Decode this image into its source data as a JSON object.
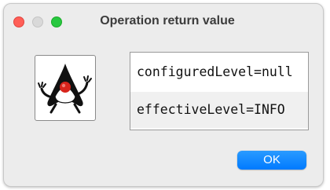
{
  "window": {
    "title": "Operation return value"
  },
  "icons": {
    "app": "java-duke-icon"
  },
  "result": {
    "rows": [
      "configuredLevel=null",
      "effectiveLevel=INFO"
    ]
  },
  "buttons": {
    "ok_label": "OK"
  },
  "colors": {
    "accent": "#007aff",
    "close": "#ff5f57",
    "minimize": "#d9d9d9",
    "zoom": "#28c840"
  }
}
